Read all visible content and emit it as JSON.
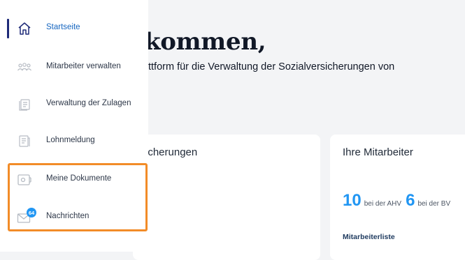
{
  "welcome": {
    "title": "kommen,",
    "subtitle": "ttform für die Verwaltung der Sozialversicherungen von"
  },
  "cards": {
    "insurance": {
      "title": "icherungen"
    },
    "employees": {
      "title": "Ihre Mitarbeiter",
      "ahv_count": "10",
      "ahv_label": "bei der AHV",
      "bv_count": "6",
      "bv_label": "bei der BV",
      "link_label": "Mitarbeiterliste"
    }
  },
  "sidebar": {
    "items": [
      {
        "label": "Startseite",
        "icon": "home-icon",
        "active": true
      },
      {
        "label": "Mitarbeiter verwalten",
        "icon": "users-icon"
      },
      {
        "label": "Verwaltung der Zulagen",
        "icon": "allowance-icon"
      },
      {
        "label": "Lohnmeldung",
        "icon": "payroll-icon"
      },
      {
        "label": "Meine Dokumente",
        "icon": "documents-safe-icon"
      },
      {
        "label": "Nachrichten",
        "icon": "mail-icon",
        "badge": "64"
      }
    ]
  },
  "colors": {
    "accent": "#2196f3",
    "active_bar": "#1e2a78",
    "highlight": "#f28c28",
    "icon_gray": "#b7bcc4"
  }
}
